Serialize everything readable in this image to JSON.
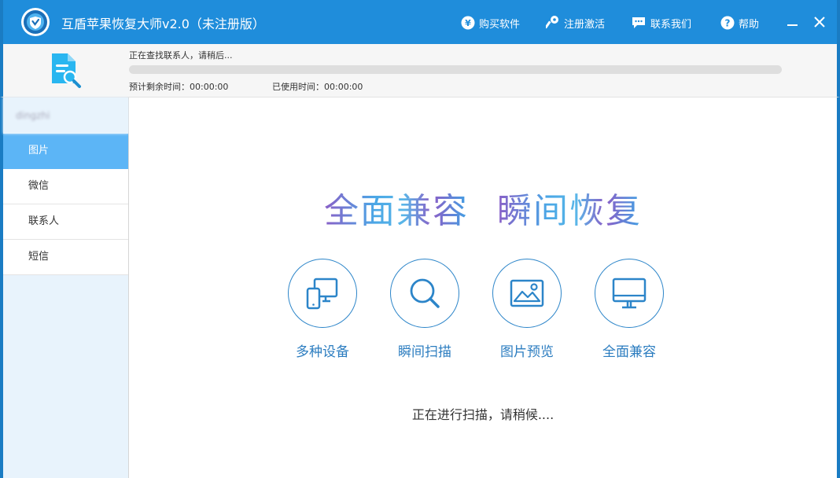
{
  "app": {
    "title": "互盾苹果恢复大师v2.0（未注册版）"
  },
  "toolbar": {
    "buy_label": "购买软件",
    "register_label": "注册激活",
    "contact_label": "联系我们",
    "help_label": "帮助"
  },
  "progress": {
    "status": "正在查找联系人，请稍后...",
    "percent": 0,
    "remaining_label": "预计剩余时间：00:00:00",
    "elapsed_label": "已使用时间：00:00:00"
  },
  "sidebar": {
    "device_name": "dingzhi",
    "items": [
      {
        "label": "图片",
        "active": true
      },
      {
        "label": "微信",
        "active": false
      },
      {
        "label": "联系人",
        "active": false
      },
      {
        "label": "短信",
        "active": false
      }
    ]
  },
  "main": {
    "slogan_left": "全面兼容",
    "slogan_right": "瞬间恢复",
    "features": [
      {
        "label": "多种设备",
        "icon": "devices-icon"
      },
      {
        "label": "瞬间扫描",
        "icon": "magnifier-icon"
      },
      {
        "label": "图片预览",
        "icon": "picture-icon"
      },
      {
        "label": "全面兼容",
        "icon": "monitor-icon"
      }
    ],
    "scan_status": "正在进行扫描，请稍候...."
  },
  "colors": {
    "titlebar": "#1f8ddb",
    "sidebar_active": "#5cb5f6",
    "sidebar_bg": "#e8f3fc",
    "feature_accent": "#2c85c9"
  }
}
